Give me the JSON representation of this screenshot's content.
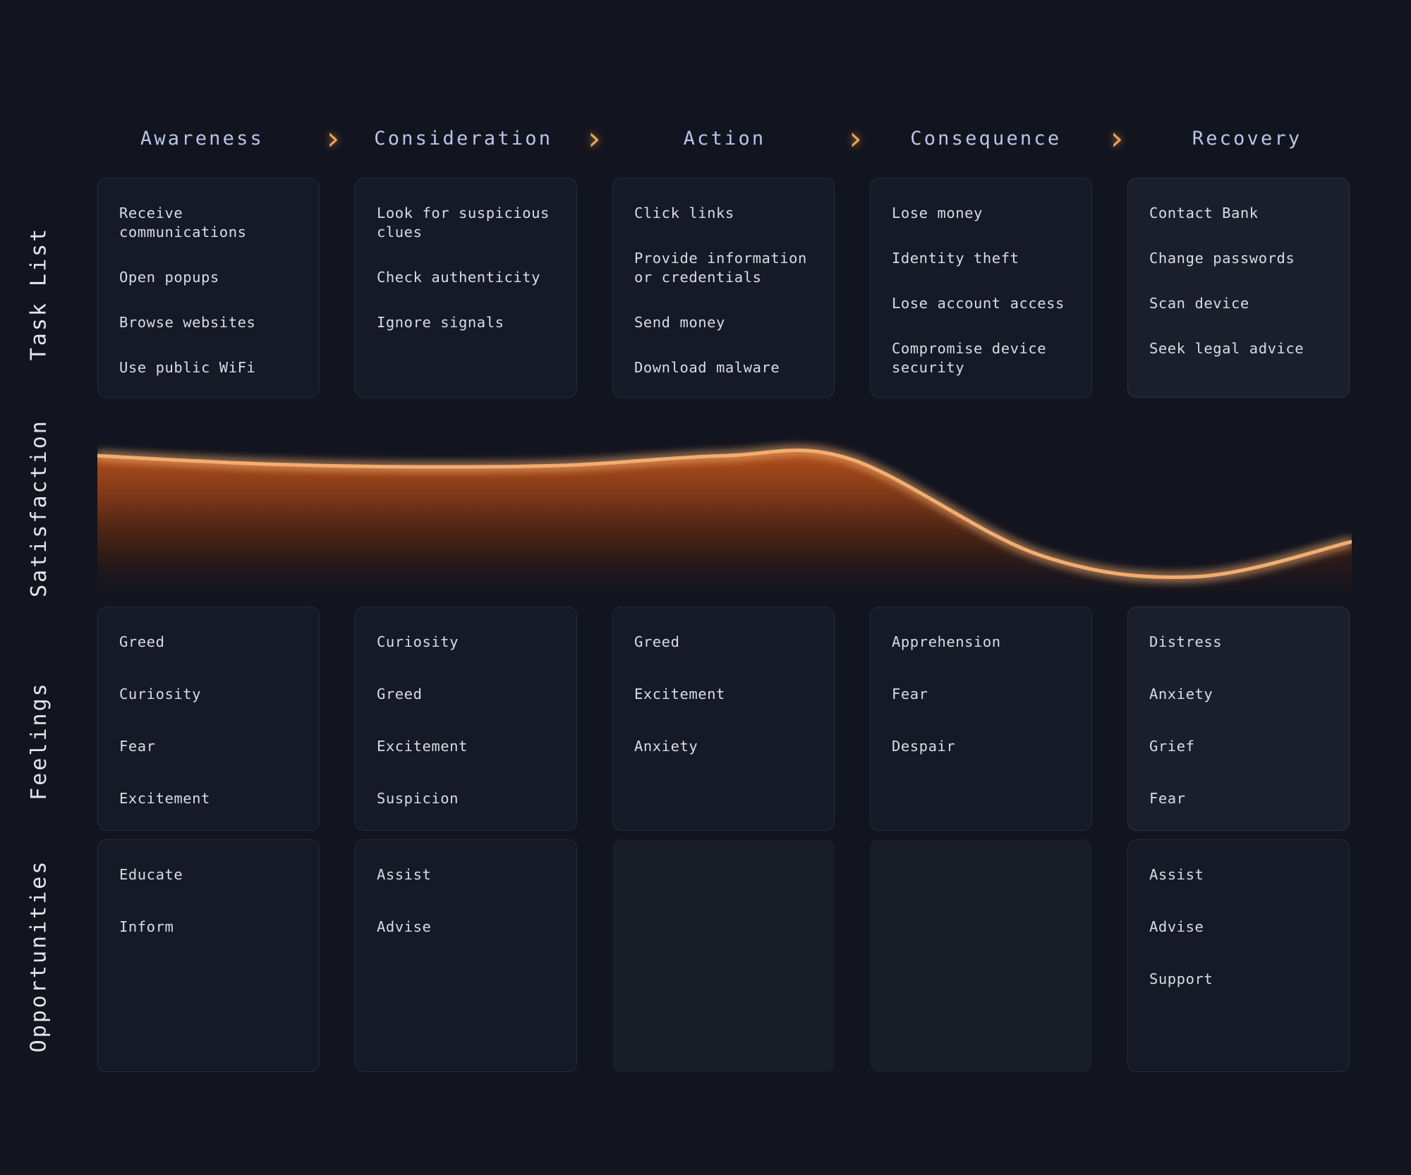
{
  "stages": [
    "Awareness",
    "Consideration",
    "Action",
    "Consequence",
    "Recovery"
  ],
  "chevron_glyph": "›",
  "row_labels": {
    "tasks": "Task List",
    "satisfaction": "Satisfaction",
    "feelings": "Feelings",
    "opportunities": "Opportunities"
  },
  "colors": {
    "background": "#12141f",
    "card": "#161a26",
    "card_light": "#1a1f2b",
    "card_empty": "#181d28",
    "card_border": "#262b3c",
    "header_text": "#b9c5ea",
    "body_text": "#d9dce6",
    "accent": "#f0a867",
    "accent_glow": "#e89646"
  },
  "tasks": [
    [
      "Receive communications",
      "Open popups",
      "Browse websites",
      "Use public WiFi"
    ],
    [
      "Look for suspicious\nclues",
      "Check authenticity",
      "Ignore signals"
    ],
    [
      "Click links",
      "Provide information\nor credentials",
      "Send money",
      "Download malware"
    ],
    [
      "Lose money",
      "Identity theft",
      "Lose account access",
      "Compromise device\nsecurity"
    ],
    [
      "Contact Bank",
      "Change passwords",
      "Scan device",
      "Seek legal advice"
    ]
  ],
  "feelings": [
    [
      "Greed",
      "Curiosity",
      "Fear",
      "Excitement"
    ],
    [
      "Curiosity",
      "Greed",
      "Excitement",
      "Suspicion"
    ],
    [
      "Greed",
      "Excitement",
      "Anxiety"
    ],
    [
      "Apprehension",
      "Fear",
      "Despair"
    ],
    [
      "Distress",
      "Anxiety",
      "Grief",
      "Fear"
    ]
  ],
  "opportunities": [
    [
      "Educate",
      "Inform"
    ],
    [
      "Assist",
      "Advise"
    ],
    [],
    [],
    [
      "Assist",
      "Advise",
      "Support"
    ]
  ],
  "chart_data": {
    "type": "line",
    "title": "Satisfaction",
    "xlabel": "",
    "ylabel": "Satisfaction",
    "categories": [
      "Awareness",
      "Consideration",
      "Action",
      "Consequence",
      "Recovery"
    ],
    "x": [
      0,
      0.5,
      1,
      1.5,
      2,
      2.4,
      3,
      3.5,
      4
    ],
    "series": [
      {
        "name": "Satisfaction",
        "values": [
          0.92,
          0.87,
          0.85,
          0.86,
          0.92,
          0.9,
          0.3,
          0.16,
          0.38
        ]
      }
    ],
    "ylim": [
      0,
      1
    ],
    "grid": false,
    "legend": "none",
    "area_fill": true,
    "stroke_color": "#f0a867",
    "fill_gradient": [
      "#8a3a14",
      "#12141f"
    ]
  }
}
